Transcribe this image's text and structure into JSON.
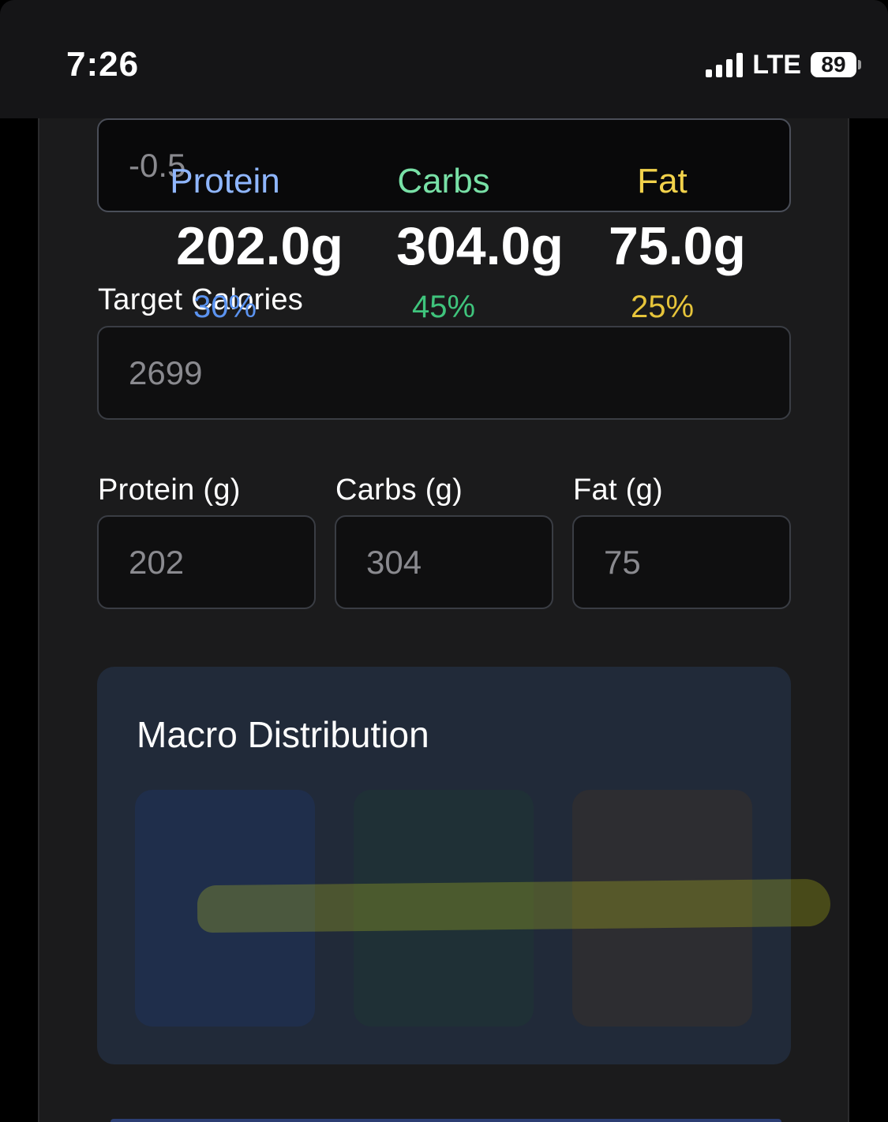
{
  "status_bar": {
    "time": "7:26",
    "network": "LTE",
    "battery": "89",
    "signal_icon": "cellular-signal-icon",
    "battery_icon": "battery-icon"
  },
  "form": {
    "first_field": {
      "value": "-0.5"
    },
    "target_calories": {
      "label": "Target Calories",
      "value": "2699"
    },
    "protein": {
      "label": "Protein (g)",
      "value": "202"
    },
    "carbs": {
      "label": "Carbs (g)",
      "value": "304"
    },
    "fat": {
      "label": "Fat (g)",
      "value": "75"
    }
  },
  "macro_distribution": {
    "title": "Macro Distribution",
    "items": [
      {
        "name": "Protein",
        "grams": "202.0g",
        "percent": "30%",
        "percent_value": 30,
        "color": "#8fb6ff",
        "pct_color": "#5b93f0"
      },
      {
        "name": "Carbs",
        "grams": "304.0g",
        "percent": "45%",
        "percent_value": 45,
        "color": "#78e0a6",
        "pct_color": "#3fc47c"
      },
      {
        "name": "Fat",
        "grams": "75.0g",
        "percent": "25%",
        "percent_value": 25,
        "color": "#f2d24b",
        "pct_color": "#e6c43a"
      }
    ]
  },
  "colors": {
    "background": "#000000",
    "panel": "#1b1b1c",
    "card": "#212a39",
    "highlighter": "#e6f014"
  }
}
